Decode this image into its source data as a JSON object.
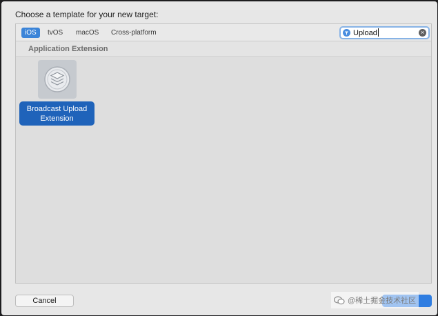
{
  "dialog": {
    "title": "Choose a template for your new target:"
  },
  "tabs": [
    {
      "label": "iOS",
      "selected": true
    },
    {
      "label": "tvOS",
      "selected": false
    },
    {
      "label": "macOS",
      "selected": false
    },
    {
      "label": "Cross-platform",
      "selected": false
    }
  ],
  "search": {
    "value": "Upload",
    "icon": "filter-icon",
    "clear_icon": "clear-icon"
  },
  "section": {
    "title": "Application Extension"
  },
  "templates": [
    {
      "label_line1": "Broadcast Upload",
      "label_line2": "Extension",
      "icon": "broadcast-extension-icon",
      "selected": true
    }
  ],
  "buttons": {
    "cancel": "Cancel",
    "next": ""
  },
  "watermark": {
    "text": "@稀土掘金技术社区",
    "icon": "wechat-icon"
  },
  "colors": {
    "accent": "#3b84d8",
    "selection": "#1f63ba"
  }
}
